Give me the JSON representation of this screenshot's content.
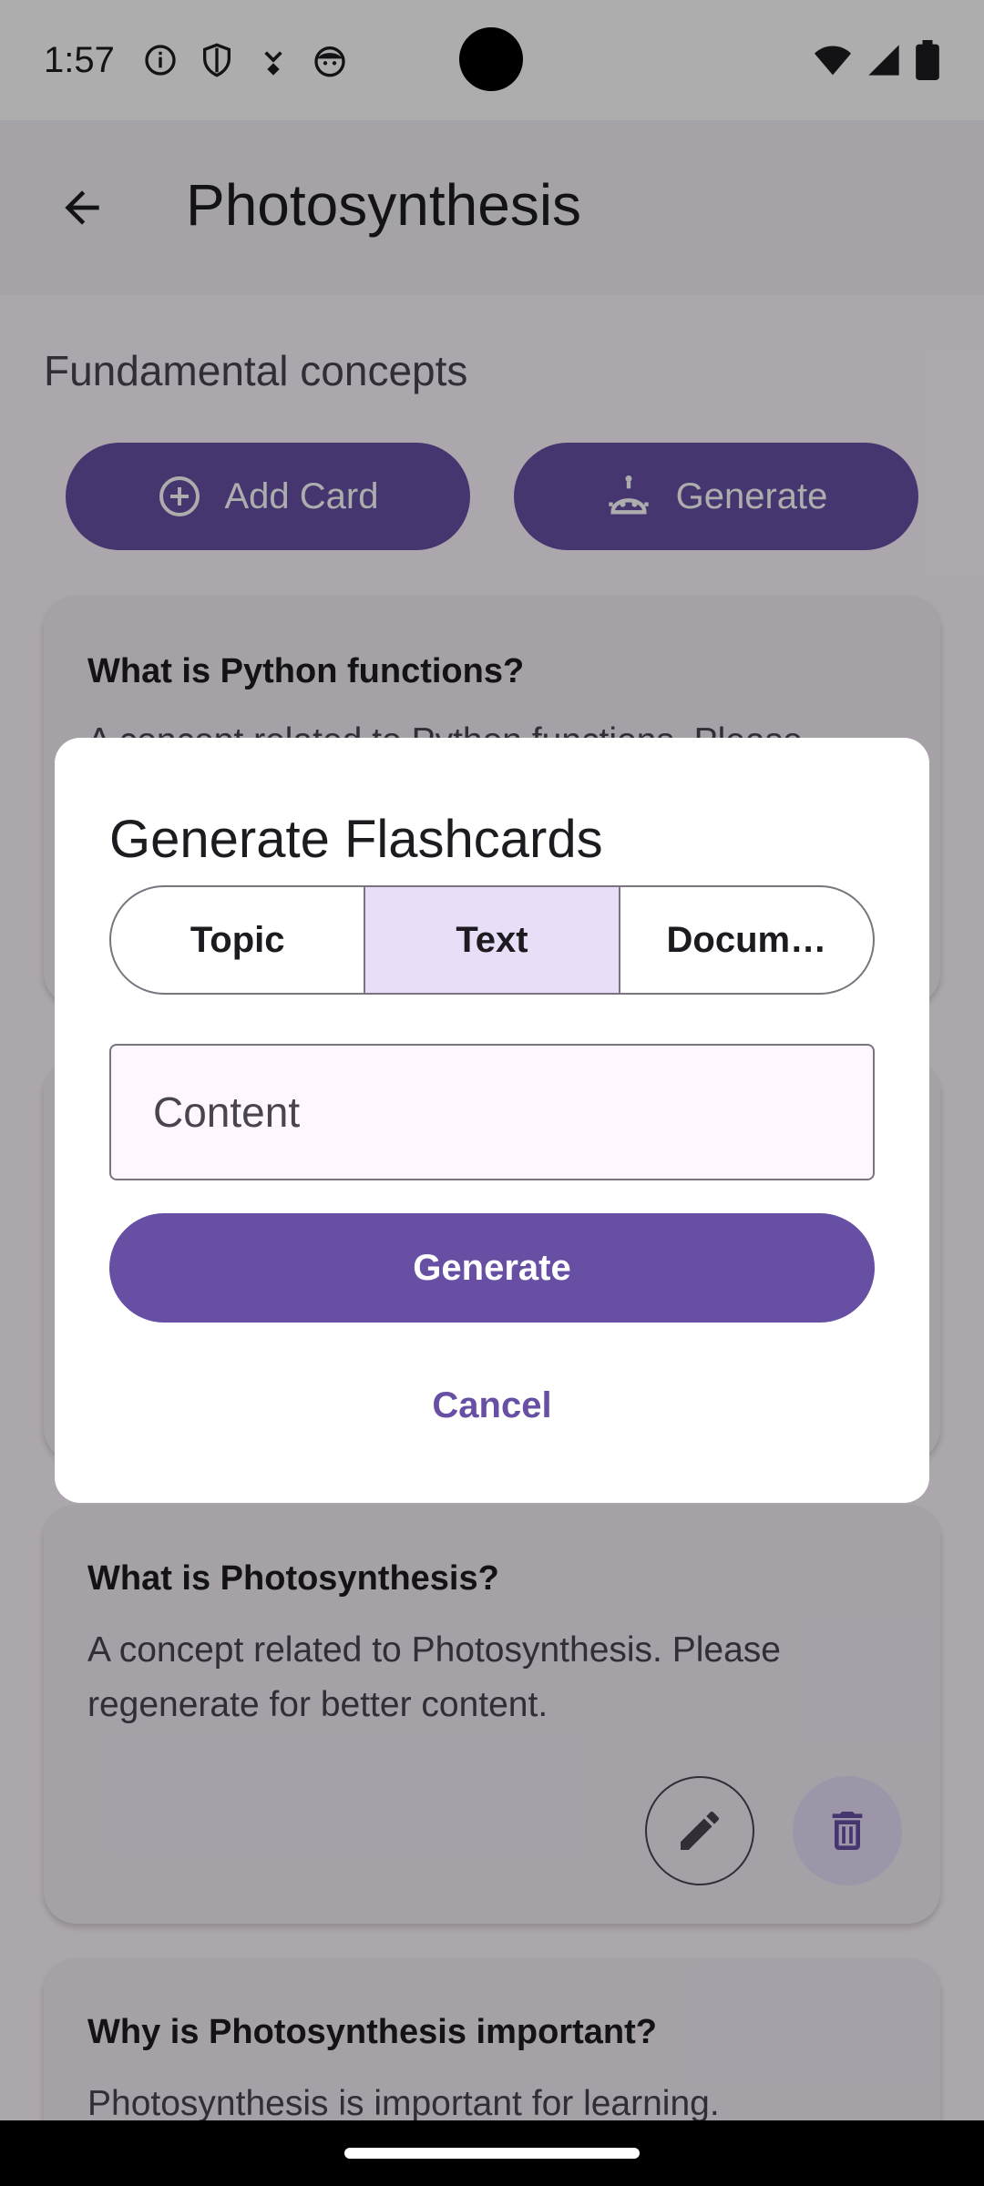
{
  "status": {
    "time": "1:57"
  },
  "appbar": {
    "title": "Photosynthesis"
  },
  "section": {
    "label": "Fundamental concepts"
  },
  "actions": {
    "add_card": "Add Card",
    "generate": "Generate"
  },
  "cards": [
    {
      "question": "What is Python functions?",
      "answer": "A concept related to Python functions. Please"
    },
    {
      "question": "What is Photosynthesis?",
      "answer": "A concept related to Photosynthesis. Please regenerate for better content."
    },
    {
      "question": "Why is Photosynthesis important?",
      "answer": "Photosynthesis is important for learning."
    }
  ],
  "dialog": {
    "title": "Generate Flashcards",
    "tabs": [
      "Topic",
      "Text",
      "Docum…"
    ],
    "selected_tab": "Text",
    "content_placeholder": "Content",
    "generate_label": "Generate",
    "cancel_label": "Cancel"
  },
  "colors": {
    "primary": "#6750a4",
    "secondary_container": "#e8def8",
    "surface": "#fef7ff"
  }
}
